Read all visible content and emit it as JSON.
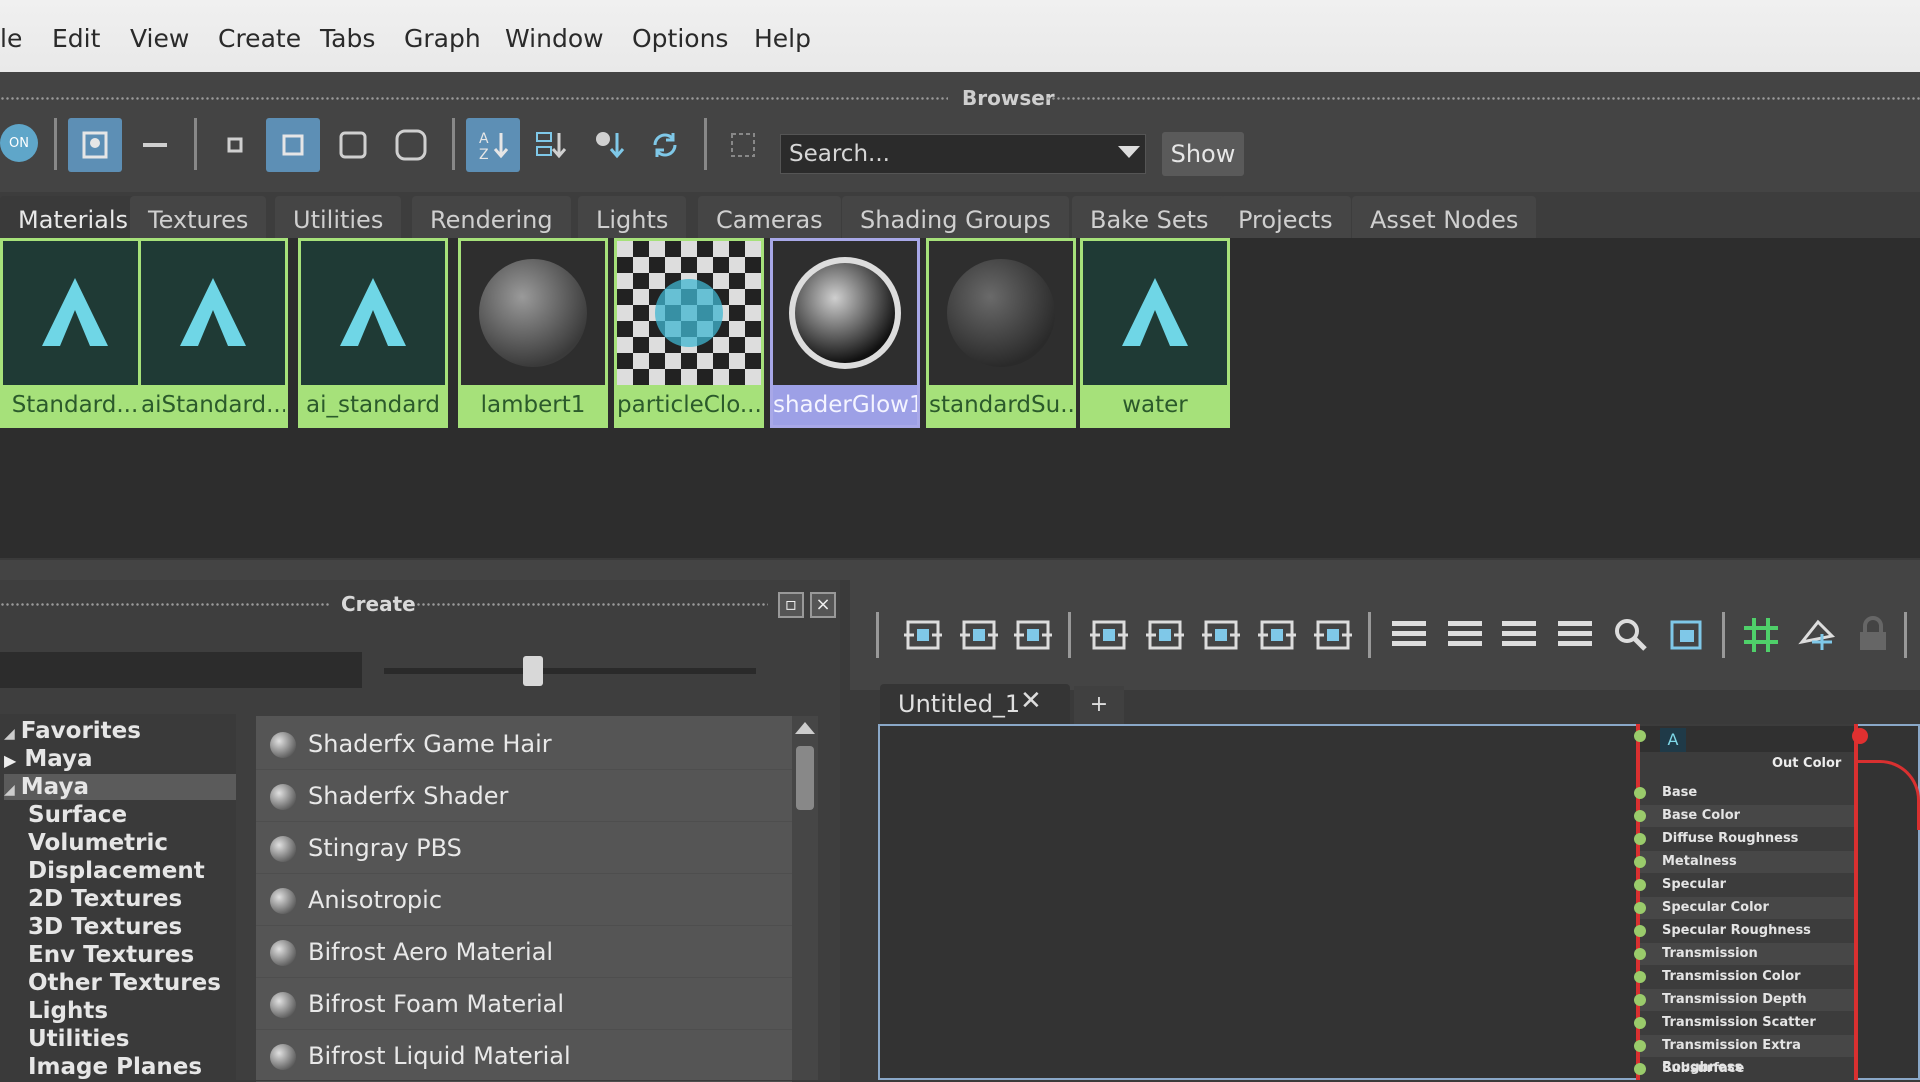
{
  "menu": [
    "le",
    "Edit",
    "View",
    "Create",
    "Tabs",
    "Graph",
    "Window",
    "Options",
    "Help"
  ],
  "browser": {
    "title": "Browser",
    "search_placeholder": "Search...",
    "show_label": "Show",
    "toggle_label": "ON"
  },
  "tabs": [
    "Materials",
    "Textures",
    "Utilities",
    "Rendering",
    "Lights",
    "Cameras",
    "Shading Groups",
    "Bake Sets",
    "Projects",
    "Asset Nodes"
  ],
  "swatches": [
    {
      "label": "Standard...",
      "type": "arnold"
    },
    {
      "label": "aiStandard...",
      "type": "arnold"
    },
    {
      "label": "ai_standard",
      "type": "arnold"
    },
    {
      "label": "lambert1",
      "type": "sphere-grey"
    },
    {
      "label": "particleClo...",
      "type": "checker"
    },
    {
      "label": "shaderGlow1",
      "type": "sphere-glow",
      "selected": true
    },
    {
      "label": "standardSu...",
      "type": "sphere-dark"
    },
    {
      "label": "water",
      "type": "arnold"
    }
  ],
  "create": {
    "title": "Create",
    "tree": [
      {
        "label": "Favorites",
        "level": 0,
        "expanded": true
      },
      {
        "label": "Maya",
        "level": 1,
        "expanded": false
      },
      {
        "label": "Maya",
        "level": 0,
        "expanded": true,
        "highlight": true
      },
      {
        "label": "Surface",
        "level": 1
      },
      {
        "label": "Volumetric",
        "level": 1
      },
      {
        "label": "Displacement",
        "level": 1
      },
      {
        "label": "2D Textures",
        "level": 1
      },
      {
        "label": "3D Textures",
        "level": 1
      },
      {
        "label": "Env Textures",
        "level": 1
      },
      {
        "label": "Other Textures",
        "level": 1
      },
      {
        "label": "Lights",
        "level": 1
      },
      {
        "label": "Utilities",
        "level": 1
      },
      {
        "label": "Image Planes",
        "level": 1
      }
    ],
    "items": [
      "Shaderfx Game Hair",
      "Shaderfx Shader",
      "Stingray PBS",
      "Anisotropic",
      "Bifrost Aero Material",
      "Bifrost Foam Material",
      "Bifrost Liquid Material"
    ],
    "slider_value": 0.4
  },
  "graph": {
    "tab_label": "Untitled_1",
    "add_tab": "+",
    "node": {
      "output": "Out Color",
      "attributes": [
        "Base",
        "Base Color",
        "Diffuse Roughness",
        "Metalness",
        "Specular",
        "Specular Color",
        "Specular Roughness",
        "Transmission",
        "Transmission Color",
        "Transmission Depth",
        "Transmission Scatter",
        "Transmission Extra Roughness",
        "Subsurface"
      ]
    }
  },
  "colors": {
    "swatch_border": "#a6e17a",
    "selected_border": "#9da0e6",
    "wire": "#d93030",
    "active_button": "#5d8fb5"
  }
}
